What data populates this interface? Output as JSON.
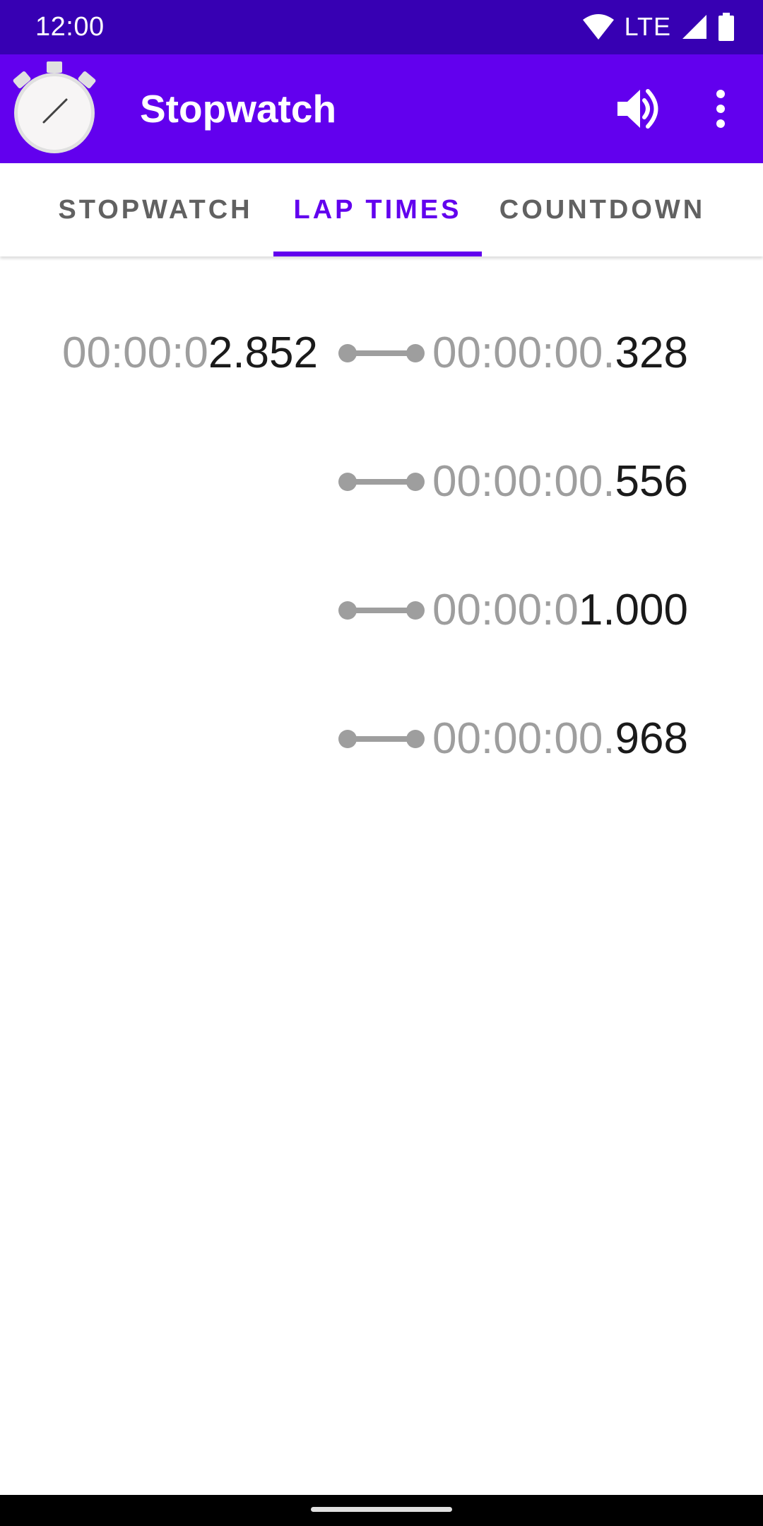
{
  "status_bar": {
    "time": "12:00",
    "network": "LTE",
    "icons": [
      "wifi-icon",
      "cell-signal-icon",
      "battery-icon"
    ]
  },
  "app_bar": {
    "title": "Stopwatch",
    "logo_icon": "stopwatch-logo-icon",
    "actions": [
      "volume-icon",
      "more-vert-icon"
    ]
  },
  "tabs": [
    {
      "label": "STOPWATCH",
      "selected": false
    },
    {
      "label": "LAP TIMES",
      "selected": true
    },
    {
      "label": "COUNTDOWN",
      "selected": false
    }
  ],
  "laps": [
    {
      "total_dim": "00:00:0",
      "total_bold": "2.852",
      "lap_dim": "00:00:00.",
      "lap_bold": "328"
    },
    {
      "total_dim": "",
      "total_bold": "",
      "lap_dim": "00:00:00.",
      "lap_bold": "556"
    },
    {
      "total_dim": "",
      "total_bold": "",
      "lap_dim": "00:00:0",
      "lap_bold": "1.000"
    },
    {
      "total_dim": "",
      "total_bold": "",
      "lap_dim": "00:00:00.",
      "lap_bold": "968"
    }
  ],
  "colors": {
    "status_bar": "#3700b3",
    "primary": "#6200ee",
    "tab_inactive": "#616161",
    "time_dim": "#9e9e9e",
    "time_main": "#1a1a1a",
    "connector": "#9e9e9e"
  }
}
